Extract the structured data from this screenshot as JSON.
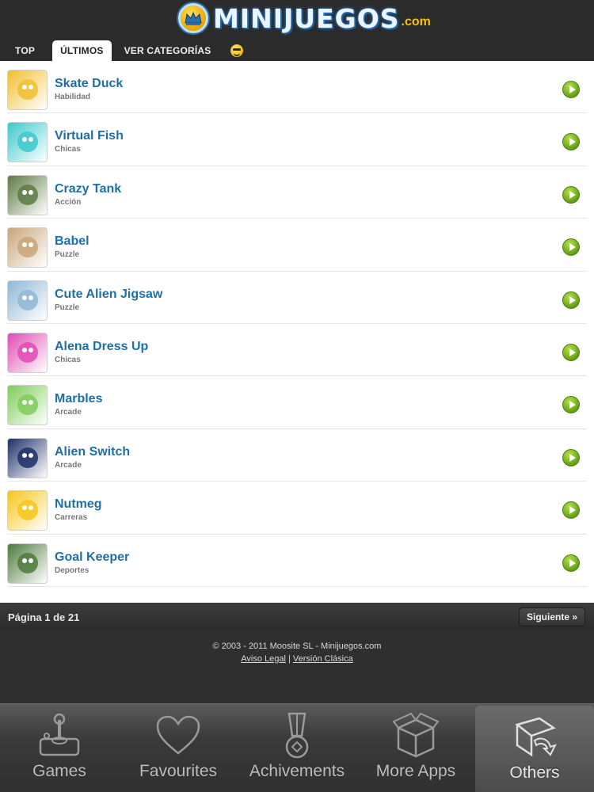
{
  "header": {
    "logo_text": "MINIJUEGOS",
    "logo_domain": ".com",
    "tabs": [
      {
        "label": "TOP"
      },
      {
        "label": "ÚLTIMOS",
        "active": true
      },
      {
        "label": "VER CATEGORÍAS"
      }
    ],
    "emoji_tab_icon": "smiley-icon"
  },
  "games": [
    {
      "title": "Skate Duck",
      "category": "Habilidad",
      "thumb_color": "#f0c030"
    },
    {
      "title": "Virtual Fish",
      "category": "Chicas",
      "thumb_color": "#3cc9cc"
    },
    {
      "title": "Crazy Tank",
      "category": "Acción",
      "thumb_color": "#5d7a43"
    },
    {
      "title": "Babel",
      "category": "Puzzle",
      "thumb_color": "#c9a57a"
    },
    {
      "title": "Cute Alien Jigsaw",
      "category": "Puzzle",
      "thumb_color": "#8fb7d6"
    },
    {
      "title": "Alena Dress Up",
      "category": "Chicas",
      "thumb_color": "#e04bb4"
    },
    {
      "title": "Marbles",
      "category": "Arcade",
      "thumb_color": "#7fcc5a"
    },
    {
      "title": "Alien Switch",
      "category": "Arcade",
      "thumb_color": "#1d2f6a"
    },
    {
      "title": "Nutmeg",
      "category": "Carreras",
      "thumb_color": "#f6c61a"
    },
    {
      "title": "Goal Keeper",
      "category": "Deportes",
      "thumb_color": "#4e7a3c"
    }
  ],
  "pager": {
    "label": "Página 1 de 21",
    "next": "Siguiente »"
  },
  "footer": {
    "copyright": "© 2003 - 2011 Moosite SL - Minijuegos.com",
    "link_legal": "Aviso Legal",
    "separator": " | ",
    "link_classic": "Versión Clásica"
  },
  "tabbar": {
    "items": [
      {
        "label": "Games",
        "icon": "joystick-icon"
      },
      {
        "label": "Favourites",
        "icon": "heart-icon"
      },
      {
        "label": "Achivements",
        "icon": "medal-icon"
      },
      {
        "label": "More Apps",
        "icon": "box-icon"
      },
      {
        "label": "Others",
        "icon": "others-icon",
        "active": true
      }
    ]
  },
  "colors": {
    "accent_blue": "#1f6fa6",
    "play_green": "#6fae1e",
    "header_bg": "#2b2b2b"
  }
}
